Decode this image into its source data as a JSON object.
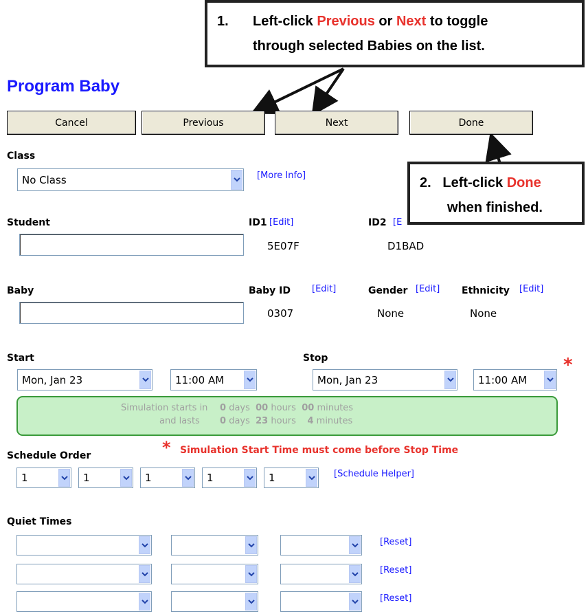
{
  "title": "Program Baby",
  "buttons": {
    "cancel": "Cancel",
    "previous": "Previous",
    "next": "Next",
    "done": "Done"
  },
  "callout1": {
    "num": "1.",
    "pre": "Left-click",
    "prev": "Previous",
    "or": "or",
    "next": "Next",
    "post": "to toggle",
    "line2": "through selected Babies on the list."
  },
  "callout2": {
    "num": "2.",
    "pre": "Left-click",
    "done": "Done",
    "line2": "when finished."
  },
  "class": {
    "label": "Class",
    "value": "No Class",
    "more_info": "[More Info]"
  },
  "student": {
    "label": "Student",
    "id1_label": "ID1",
    "id1_edit": "[Edit]",
    "id1_value": "5E07F",
    "id2_label": "ID2",
    "id2_edit": "[E",
    "id2_value": "D1BAD"
  },
  "baby": {
    "label": "Baby",
    "id_label": "Baby ID",
    "id_edit": "[Edit]",
    "id_value": "0307",
    "gender_label": "Gender",
    "gender_edit": "[Edit]",
    "gender_value": "None",
    "ethnicity_label": "Ethnicity",
    "ethnicity_edit": "[Edit]",
    "ethnicity_value": "None"
  },
  "start": {
    "label": "Start",
    "date": "Mon, Jan 23",
    "time": "11:00 AM"
  },
  "stop": {
    "label": "Stop",
    "date": "Mon, Jan 23",
    "time": "11:00 AM",
    "asterisk": "*"
  },
  "simulation": {
    "starts_label": "Simulation starts in",
    "lasts_label": "and lasts",
    "start_days": "0",
    "start_hours": "00",
    "start_minutes": "00",
    "last_days": "0",
    "last_hours": "23",
    "last_minutes": "4",
    "days": "days",
    "hours": "hours",
    "minutes": "minutes"
  },
  "error": {
    "asterisk": "*",
    "text": "Simulation Start Time must come before Stop Time"
  },
  "schedule": {
    "label": "Schedule Order",
    "values": [
      "1",
      "1",
      "1",
      "1",
      "1"
    ],
    "helper": "[Schedule Helper]"
  },
  "quiet": {
    "label": "Quiet Times",
    "reset": "[Reset]"
  },
  "colors": {
    "accent": "#1a1aff",
    "callout_red": "#e8322c",
    "panel_green": "#c8f0c8"
  }
}
